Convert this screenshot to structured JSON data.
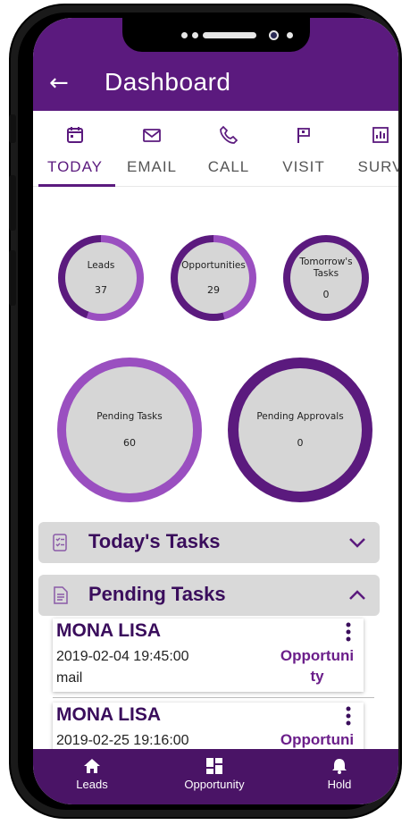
{
  "header": {
    "title": "Dashboard",
    "back_icon": "arrow-left-icon"
  },
  "tabs": [
    {
      "label": "TODAY",
      "icon": "calendar-icon",
      "active": true
    },
    {
      "label": "EMAIL",
      "icon": "envelope-icon",
      "active": false
    },
    {
      "label": "CALL",
      "icon": "phone-icon",
      "active": false
    },
    {
      "label": "VISIT",
      "icon": "flag-icon",
      "active": false
    },
    {
      "label": "SURV",
      "icon": "bar-chart-icon",
      "active": false
    }
  ],
  "stats": {
    "leads": {
      "label": "Leads",
      "value": "37"
    },
    "opportunities": {
      "label": "Opportunities",
      "value": "29"
    },
    "tomorrows_tasks": {
      "label": "Tomorrow's Tasks",
      "value": "0"
    },
    "pending_tasks": {
      "label": "Pending Tasks",
      "value": "60"
    },
    "pending_approvals": {
      "label": "Pending Approvals",
      "value": "0"
    }
  },
  "sections": {
    "todays_tasks": {
      "title": "Today's Tasks",
      "icon": "checklist-icon",
      "chevron": "chevron-down-icon"
    },
    "pending_tasks": {
      "title": "Pending Tasks",
      "icon": "document-icon",
      "chevron": "chevron-up-icon"
    }
  },
  "pending_items": [
    {
      "name": "MONA LISA",
      "datetime": "2019-02-04 19:45:00",
      "type": "mail",
      "category_line1": "Opportuni",
      "category_line2": "ty"
    },
    {
      "name": "MONA LISA",
      "datetime": "2019-02-25 19:16:00",
      "type": "",
      "category_line1": "Opportuni",
      "category_line2": ""
    }
  ],
  "bottom_nav": [
    {
      "label": "Leads",
      "icon": "home-icon"
    },
    {
      "label": "Opportunity",
      "icon": "grid-icon"
    },
    {
      "label": "Hold",
      "icon": "bell-icon"
    }
  ],
  "colors": {
    "primary": "#5b1a7e",
    "ring_dark": "#5b1a7e",
    "ring_light": "#9a4fc0",
    "circle_fill": "#d6d6d6",
    "bottom_nav": "#4a1466"
  }
}
